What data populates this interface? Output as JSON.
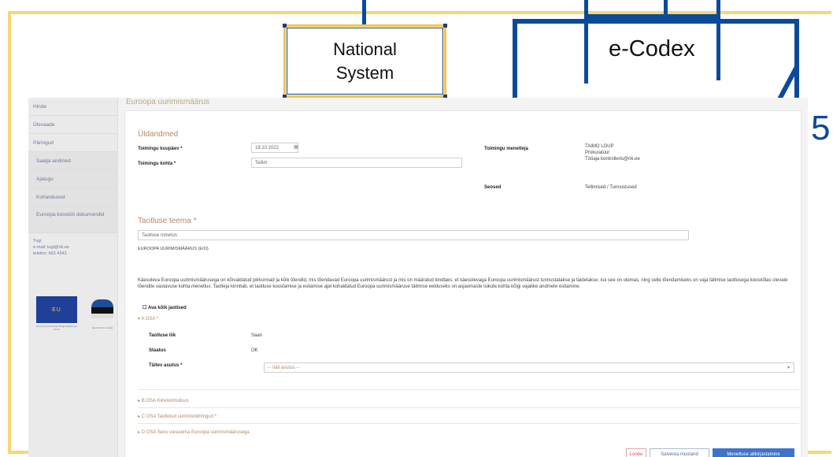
{
  "diagram": {
    "national_system_label_line1": "National",
    "national_system_label_line2": "System",
    "ecodex_label": "e-Codex",
    "right_fragment": "5"
  },
  "screenshot": {
    "page_heading": "Euroopa uurimismäärus",
    "sidebar": {
      "items": [
        "Hinde",
        "Ülevaade",
        "Päringud",
        "Saatja andmed",
        "Ajalugu",
        "Kohandused",
        "Euroopa koostöö dokumendid"
      ],
      "contact_lines": [
        "Tugi",
        "e-mail: tugi@rik.ee",
        "telefon: 663 4343"
      ],
      "eu_text": "EU",
      "eu_caption": "Euroopa Liit Euroopa Regionaalarengu Fond",
      "ee_caption": "Eesti tuleviku heaks"
    },
    "general": {
      "title": "Üldandmed",
      "date_label": "Toimingu kuupäev *",
      "date_value": "18.10.2022",
      "name_label": "Toimingu kohta *",
      "name_value": "Tellim",
      "operator_label": "Toimingu menetleja",
      "operator_lines": [
        "TAIMO LOUP",
        "Prokuratuur",
        "Tööaja kontrolleris@rik.ee"
      ],
      "related_label": "Seosed",
      "related_value": "Tellimised / Tunnustused"
    },
    "request": {
      "title": "Taotluse teema *",
      "placeholder": "Taotluse nimetus",
      "form_code": "EUROOPA UURIMISMÄÄRUS (EIO)",
      "paragraph": "Käesoleva Euroopa uurimismäärusega on kõrvaldatud piirkonnad ja kõik tõendid, mis tõendavad Euroopa uurimismäärust ja mis on määratud kindlaks, et käesolevaga Euroopa uurimismäärust tunnustatakse ja täidetakse, kui see on olemas, ning selle tõendamiseks on vaja täitmise taotlusega kooskõlas olevate tõendite vastavuse kohta menetlus. Taotleja kinnitab, et taotluse koostamise ja esitamise ajal kohaldatud Euroopa uurimismääruse täitmise eelduseks on asjaomaste isikute kohta kõigi vajalike andmete esitamine.",
      "checkbox_label": "Ava kõik jaotised"
    },
    "section_a": {
      "title": "A OSA *",
      "type_label": "Taotluse liik",
      "type_value": "Saan",
      "status_label": "Staatus",
      "status_value": "OK",
      "country_label": "Täitev asutus *",
      "country_placeholder": "-- Vali asutus --"
    },
    "collapsed_sections": [
      "B OSA  Kiireloomulisus",
      "C OSA  Taotletud uurimistoimingud *",
      "D OSA  Seos varasema Euroopa uurimismäärusega"
    ],
    "buttons": {
      "cancel": "Loobu",
      "save_draft": "Salvesta mustand",
      "submit": "Menetluse allkirjastamine"
    }
  }
}
